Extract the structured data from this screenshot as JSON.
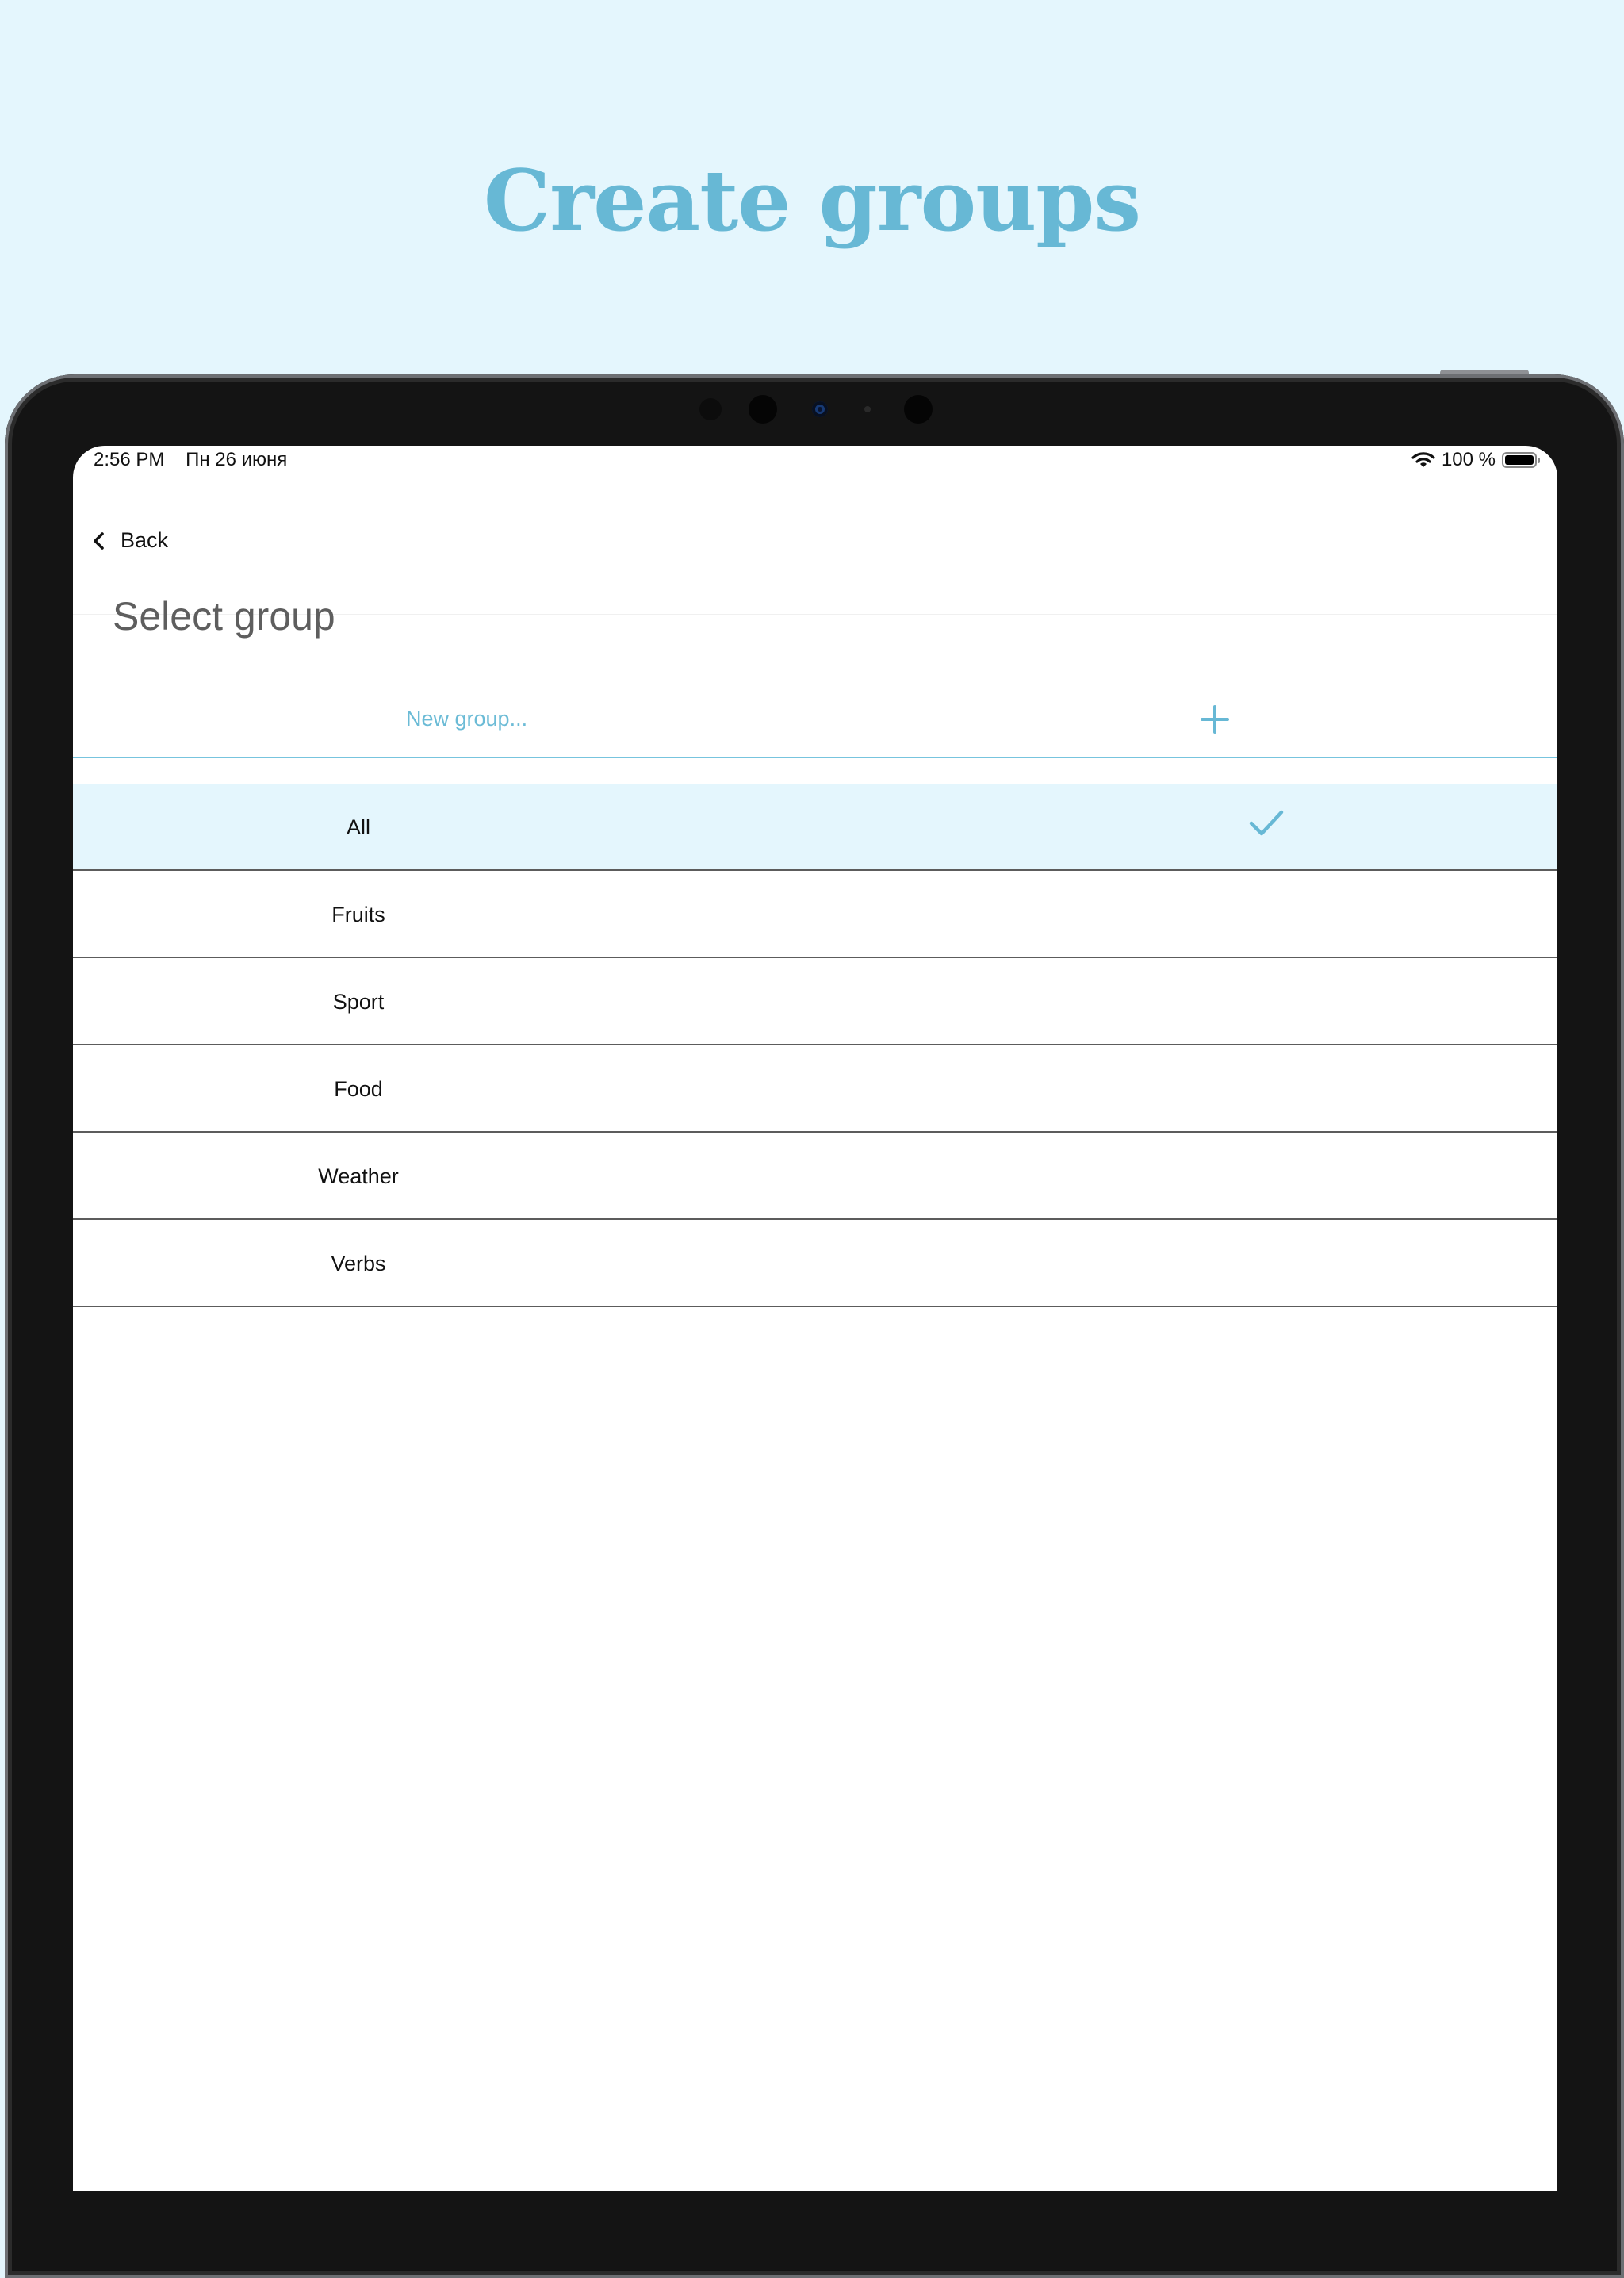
{
  "headline": "Create groups",
  "status_bar": {
    "time": "2:56 PM",
    "date": "Пн 26 июня",
    "battery": "100 %"
  },
  "nav": {
    "back_label": "Back"
  },
  "page_title": "Select group",
  "new_group": {
    "placeholder": "New group..."
  },
  "groups": [
    {
      "label": "All",
      "selected": true
    },
    {
      "label": "Fruits",
      "selected": false
    },
    {
      "label": "Sport",
      "selected": false
    },
    {
      "label": "Food",
      "selected": false
    },
    {
      "label": "Weather",
      "selected": false
    },
    {
      "label": "Verbs",
      "selected": false
    }
  ],
  "colors": {
    "accent": "#67b8d5",
    "background": "#e4f6fd",
    "selected_row": "#e4f6fd",
    "divider": "#5c5c5c"
  }
}
